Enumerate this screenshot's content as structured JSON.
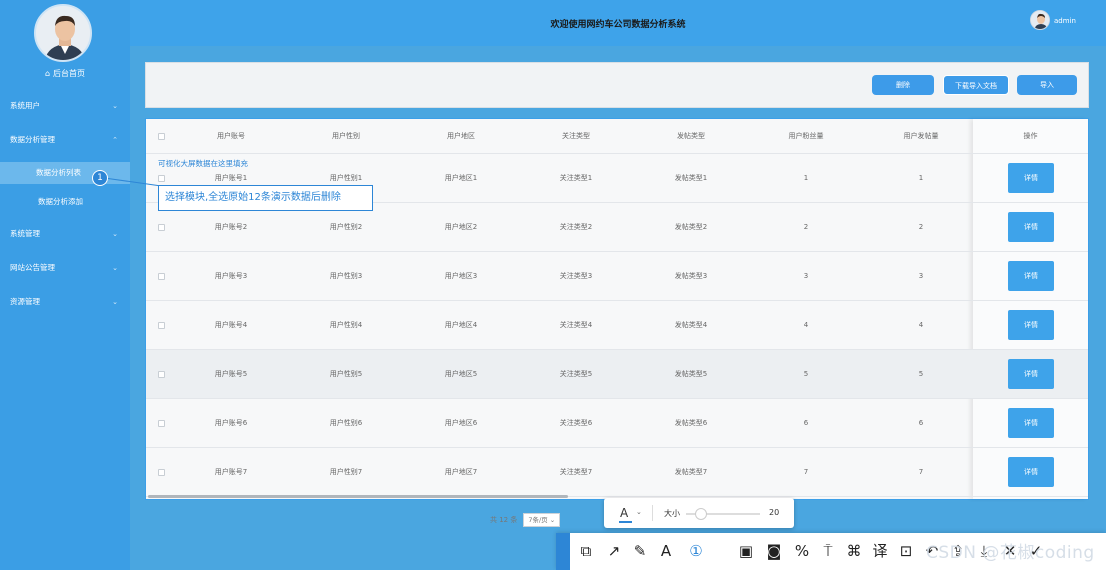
{
  "header": {
    "title": "欢迎使用网约车公司数据分析系统",
    "user_name": "admin"
  },
  "sidebar": {
    "home_label": "后台首页",
    "items": [
      {
        "label": "系统用户",
        "chevron": "⌄"
      },
      {
        "label": "数据分析管理",
        "chevron": "⌃"
      },
      {
        "label": "系统管理",
        "chevron": "⌄"
      },
      {
        "label": "网站公告管理",
        "chevron": "⌄"
      },
      {
        "label": "资源管理",
        "chevron": "⌄"
      }
    ],
    "sub_items": [
      {
        "label": "数据分析列表"
      },
      {
        "label": "数据分析添加"
      }
    ],
    "step_number": "1"
  },
  "toolbar": {
    "delete_label": "删除",
    "download_label": "下载导入文档",
    "import_label": "导入"
  },
  "table": {
    "columns": [
      "用户账号",
      "用户性别",
      "用户地区",
      "关注类型",
      "发帖类型",
      "用户粉丝量",
      "用户发帖量",
      "操作"
    ],
    "detail_label": "详情",
    "rows": [
      [
        "用户账号1",
        "用户性别1",
        "用户地区1",
        "关注类型1",
        "发帖类型1",
        "1",
        "1"
      ],
      [
        "用户账号2",
        "用户性别2",
        "用户地区2",
        "关注类型2",
        "发帖类型2",
        "2",
        "2"
      ],
      [
        "用户账号3",
        "用户性别3",
        "用户地区3",
        "关注类型3",
        "发帖类型3",
        "3",
        "3"
      ],
      [
        "用户账号4",
        "用户性别4",
        "用户地区4",
        "关注类型4",
        "发帖类型4",
        "4",
        "4"
      ],
      [
        "用户账号5",
        "用户性别5",
        "用户地区5",
        "关注类型5",
        "发帖类型5",
        "5",
        "5"
      ],
      [
        "用户账号6",
        "用户性别6",
        "用户地区6",
        "关注类型6",
        "发帖类型6",
        "6",
        "6"
      ],
      [
        "用户账号7",
        "用户性别7",
        "用户地区7",
        "关注类型7",
        "发帖类型7",
        "7",
        "7"
      ]
    ]
  },
  "annotations": {
    "fill_note": "可视化大屏数据在这里填充",
    "callout": "选择模块,全选原始12条演示数据后删除"
  },
  "pagination": {
    "total": "共 12 条",
    "page_size": "7条/页"
  },
  "text_tool": {
    "font_icon": "A",
    "chevron": "⌄",
    "size_label": "大小",
    "size_value": "20",
    "slider_fraction": 0.2
  },
  "draw_tools": [
    {
      "name": "shape-select-icon",
      "glyph": "⧉",
      "active": false
    },
    {
      "name": "arrow-icon",
      "glyph": "↗",
      "active": false
    },
    {
      "name": "pen-icon",
      "glyph": "✎",
      "active": false
    },
    {
      "name": "text-icon",
      "glyph": "A",
      "active": false
    },
    {
      "name": "number-marker-icon",
      "glyph": "①",
      "active": true
    },
    {
      "name": "mosaic-icon",
      "glyph": "▣",
      "active": false
    },
    {
      "name": "blur-icon",
      "glyph": "◙",
      "active": false
    },
    {
      "name": "percent-icon",
      "glyph": "%",
      "active": false
    },
    {
      "name": "pin-icon",
      "glyph": "⍑",
      "active": false
    },
    {
      "name": "link-icon",
      "glyph": "⌘",
      "active": false
    },
    {
      "name": "translate-icon",
      "glyph": "译",
      "active": false
    },
    {
      "name": "ocr-icon",
      "glyph": "⊡",
      "active": false
    },
    {
      "name": "undo-icon",
      "glyph": "↶",
      "active": false
    },
    {
      "name": "share-icon",
      "glyph": "⇪",
      "active": false
    },
    {
      "name": "download-icon",
      "glyph": "⤓",
      "active": false
    },
    {
      "name": "close-icon",
      "glyph": "✕",
      "active": false
    },
    {
      "name": "confirm-icon",
      "glyph": "✓",
      "active": false
    }
  ],
  "watermark": "CSDN @花椒coding",
  "colors": {
    "accent": "#3ea3ea",
    "sidebar": "#3b9ee5",
    "annotation": "#2d86d6"
  }
}
